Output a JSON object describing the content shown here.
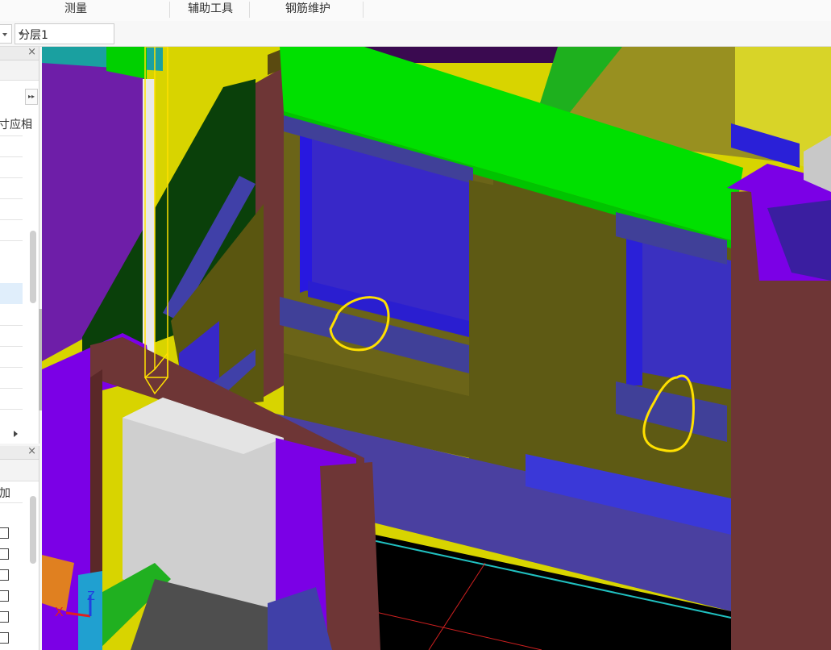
{
  "menu": {
    "items": [
      {
        "label": "测量"
      },
      {
        "label": "辅助工具"
      },
      {
        "label": "钢筋维护"
      }
    ]
  },
  "toolbar": {
    "layer_select_value": "分层1"
  },
  "left_panel_top": {
    "expand_glyph": "▸▸",
    "column_header": "寸应相",
    "close_glyph": "×"
  },
  "left_panel_bottom": {
    "column_header": "加",
    "close_glyph": "×"
  },
  "axis_labels": {
    "x": "X",
    "z": "Z"
  },
  "colors": {
    "wall_olive": "#6b6418",
    "beam_green": "#00e000",
    "window_blue": "#3828c8",
    "column_purple": "#7b00e6",
    "brown_frame": "#6e3636",
    "annotation_yellow": "#ffe000"
  }
}
